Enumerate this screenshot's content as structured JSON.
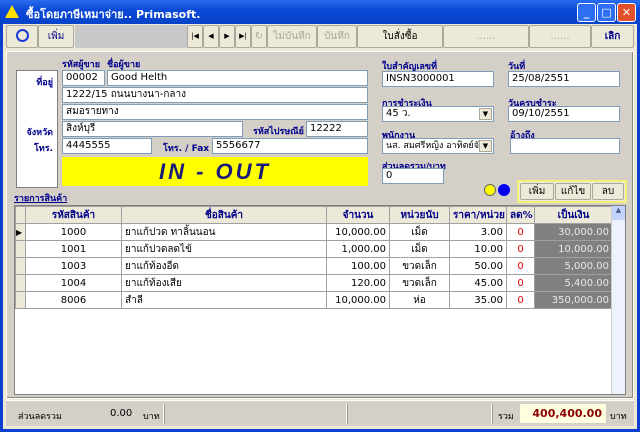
{
  "window": {
    "title": "ซื้อโดยภาษีเหมาจ่าย.. Primasoft."
  },
  "toolbar": {
    "add": "เพิ่ม",
    "nav_first": "|◀",
    "nav_prev": "◀",
    "nav_next": "▶",
    "nav_last": "▶|",
    "refresh": "↻",
    "cancel_save": "ไม่บันทึก",
    "save": "บันทึก",
    "purchase_order": "ใบสั่งซื้อ",
    "blank1": "......",
    "blank2": "......",
    "exit": "เลิก"
  },
  "vendor": {
    "code_label": "รหัสผู้ขาย",
    "name_label": "ชื่อผู้ขาย",
    "address_label": "ที่อยู่",
    "province_label": "จังหวัด",
    "phone_label": "โทร.",
    "zip_label": "รหัสไปรษณีย์",
    "fax_label": "โทร. / Fax",
    "code": "00002",
    "name": "Good Helth",
    "address1": "1222/15 ถนนบางนา-กลาง",
    "address2": "สมอรายทาง",
    "province": "สิงห์บุรี",
    "zip": "12222",
    "phone": "4445555",
    "fax": "5556677",
    "banner": "IN - OUT"
  },
  "doc": {
    "number_label": "ใบสำคัญเลขที่",
    "number": "INSN3000001",
    "date_label": "วันที่",
    "date": "25/08/2551",
    "payment_label": "การชำระเงิน",
    "payment": "45 ว.",
    "due_label": "วันครบชำระ",
    "due": "09/10/2551",
    "employee_label": "พนักงาน",
    "employee": "นส. สมศรีหญิง อาทิตย์จันร",
    "ref_label": "อ้างถึง",
    "ref": "",
    "discount_label": "ส่วนลดรวม/บาท",
    "discount": "0"
  },
  "items": {
    "title": "รายการสินค้า",
    "add": "เพิ่ม",
    "edit": "แก้ไข",
    "delete": "ลบ",
    "columns": [
      "รหัสสินค้า",
      "ชื่อสินค้า",
      "จำนวน",
      "หน่วยนับ",
      "ราคา/หน่วย",
      "ลด%",
      "เป็นเงิน"
    ],
    "rows": [
      [
        "1000",
        "ยาแก้ปวด ทาลิ้นนอน",
        "10,000.00",
        "เม็ด",
        "3.00",
        "0",
        "30,000.00"
      ],
      [
        "1001",
        "ยาแก้ปวดลดไข้",
        "1,000.00",
        "เม็ด",
        "10.00",
        "0",
        "10,000.00"
      ],
      [
        "1003",
        "ยาแก้ท้องอืด",
        "100.00",
        "ขวดเล็ก",
        "50.00",
        "0",
        "5,000.00"
      ],
      [
        "1004",
        "ยาแก้ท้องเสีย",
        "120.00",
        "ขวดเล็ก",
        "45.00",
        "0",
        "5,400.00"
      ],
      [
        "8006",
        "สำลี",
        "10,000.00",
        "ห่อ",
        "35.00",
        "0",
        "350,000.00"
      ]
    ]
  },
  "footer": {
    "discount_label": "ส่วนลดรวม",
    "discount": "0.00",
    "currency": "บาท",
    "total_label": "รวม",
    "total": "400,400.00",
    "currency2": "บาท"
  }
}
